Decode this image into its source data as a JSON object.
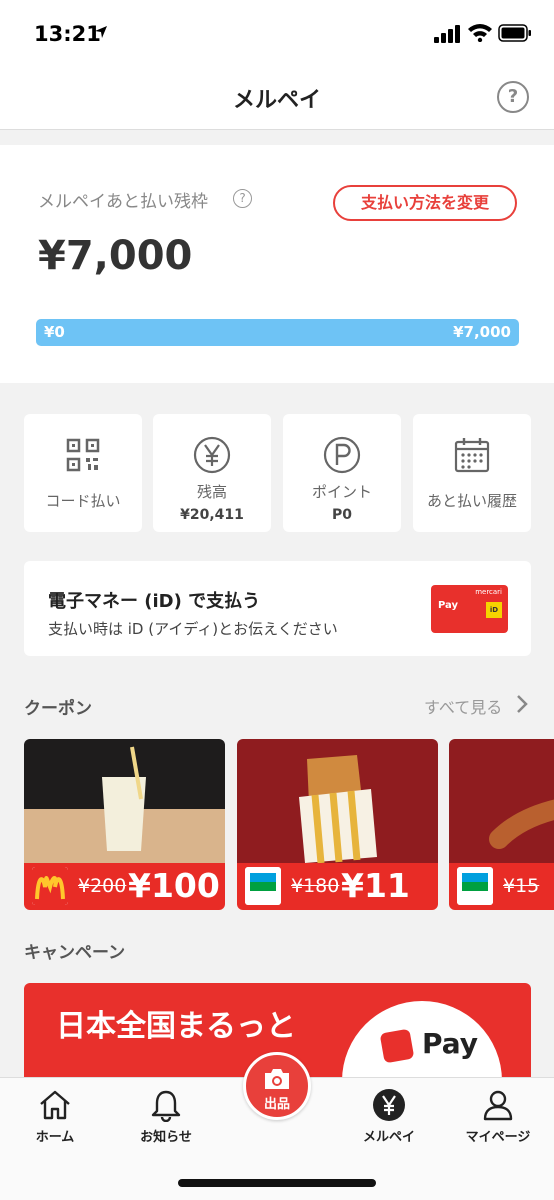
{
  "status": {
    "time": "13:21"
  },
  "nav": {
    "title": "メルペイ",
    "help": "?"
  },
  "balance": {
    "label": "メルペイあと払い残枠",
    "info": "?",
    "change_button": "支払い方法を変更",
    "amount": "¥7,000",
    "bar_min": "¥0",
    "bar_max": "¥7,000",
    "available_fraction": 1.0
  },
  "tiles": [
    {
      "label": "コード払い",
      "value": ""
    },
    {
      "label": "残高",
      "value": "¥20,411"
    },
    {
      "label": "ポイント",
      "value": "P0"
    },
    {
      "label": "あと払い履歴",
      "value": ""
    }
  ],
  "id_card": {
    "title": "電子マネー (iD) で支払う",
    "subtitle": "支払い時は iD (アイディ)とお伝えください",
    "card_brand": "mercari",
    "card_pay": "Pay",
    "card_id": "iD"
  },
  "coupons": {
    "title": "クーポン",
    "see_all": "すべて見る",
    "items": [
      {
        "brand": "mcdonalds-logo",
        "old_price": "¥200",
        "new_price": "¥100"
      },
      {
        "brand": "familymart-logo",
        "old_price": "¥180",
        "new_price": "¥11"
      },
      {
        "brand": "familymart-logo",
        "old_price": "¥15",
        "new_price": ""
      }
    ]
  },
  "campaign": {
    "title": "キャンペーン",
    "headline": "日本全国まるっと",
    "pay_text": "Pay"
  },
  "tabbar": {
    "home": "ホーム",
    "notifications": "お知らせ",
    "sell": "出品",
    "merpay": "メルペイ",
    "mypage": "マイページ"
  },
  "colors": {
    "accent": "#e8403b",
    "bar": "#6ec3f5"
  }
}
